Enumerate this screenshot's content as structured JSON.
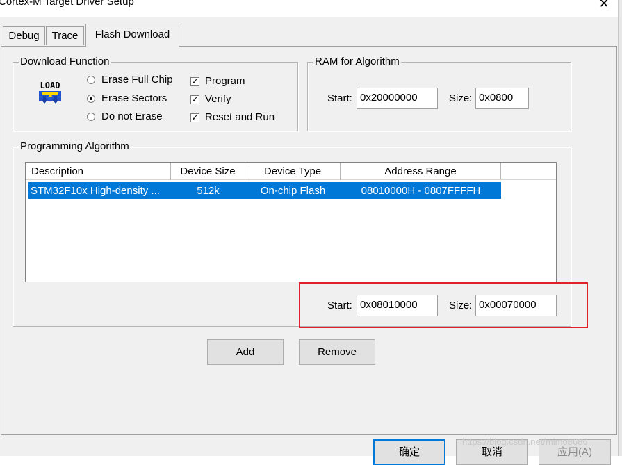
{
  "window": {
    "title": "Cortex-M Target Driver Setup",
    "close_glyph": "✕"
  },
  "tabs": [
    {
      "label": "Debug",
      "active": false
    },
    {
      "label": "Trace",
      "active": false
    },
    {
      "label": "Flash Download",
      "active": true
    }
  ],
  "download_function": {
    "legend": "Download Function",
    "icon": "load-icon",
    "icon_text": "LOAD",
    "erase_options": [
      {
        "label": "Erase Full Chip",
        "selected": false
      },
      {
        "label": "Erase Sectors",
        "selected": true
      },
      {
        "label": "Do not Erase",
        "selected": false
      }
    ],
    "checkboxes": [
      {
        "label": "Program",
        "checked": true
      },
      {
        "label": "Verify",
        "checked": true
      },
      {
        "label": "Reset and Run",
        "checked": true
      }
    ]
  },
  "ram": {
    "legend": "RAM for Algorithm",
    "start_label": "Start:",
    "start_value": "0x20000000",
    "size_label": "Size:",
    "size_value": "0x0800"
  },
  "algorithm": {
    "legend": "Programming Algorithm",
    "columns": [
      "Description",
      "Device Size",
      "Device Type",
      "Address Range"
    ],
    "rows": [
      {
        "description": "STM32F10x High-density ...",
        "size": "512k",
        "type": "On-chip Flash",
        "range": "08010000H - 0807FFFFH",
        "selected": true
      }
    ],
    "start_label": "Start:",
    "start_value": "0x08010000",
    "size_label": "Size:",
    "size_value": "0x00070000",
    "add_label": "Add",
    "remove_label": "Remove"
  },
  "footer": {
    "ok_label": "确定",
    "cancel_label": "取消",
    "apply_label": "应用(A)"
  },
  "watermark": "https://blog.csdn.net/mimo8686",
  "colors": {
    "selection": "#0078d7",
    "highlight_box": "#e0202a"
  }
}
